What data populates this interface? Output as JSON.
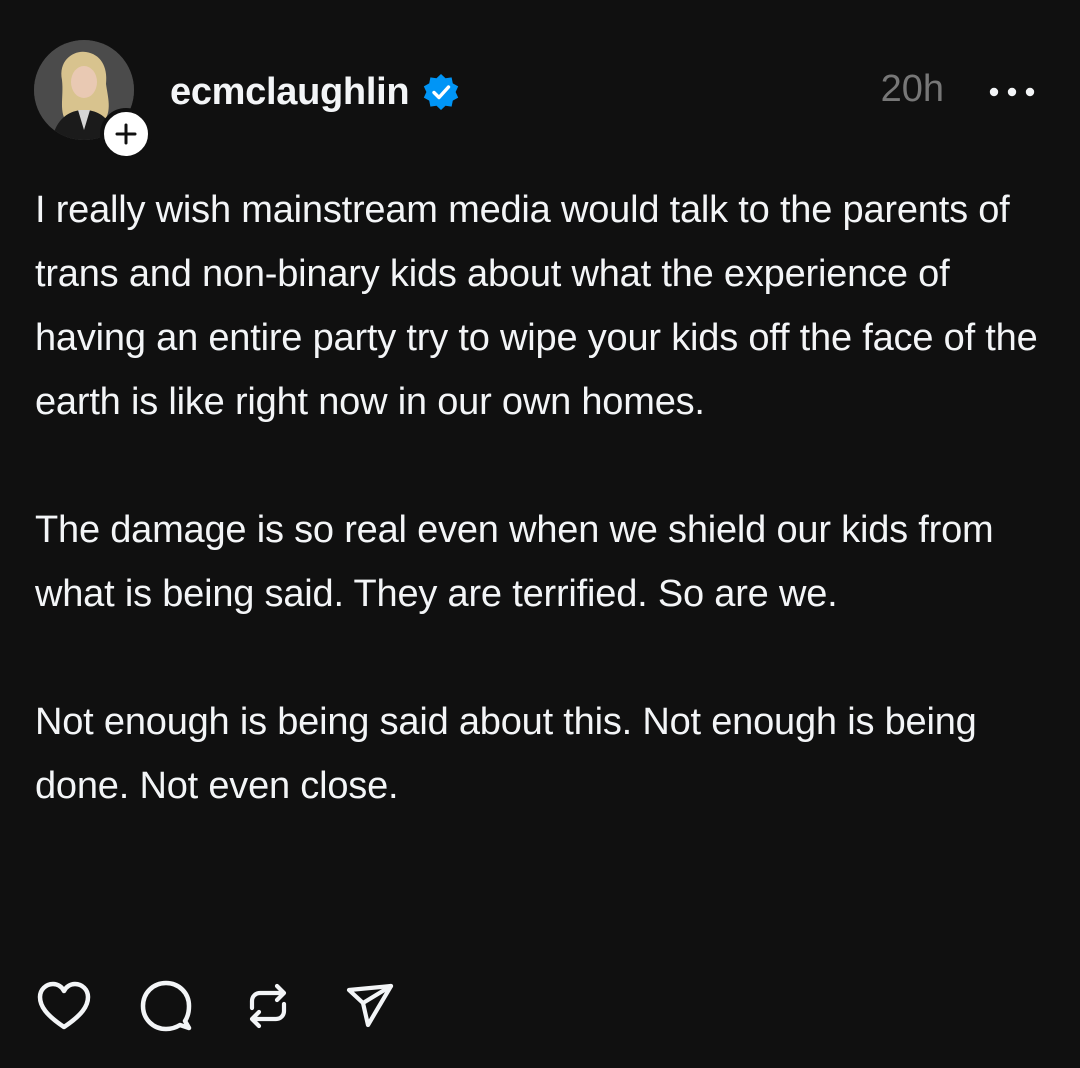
{
  "post": {
    "author": {
      "username": "ecmclaughlin",
      "verified": true,
      "avatar_icon": "profile-photo",
      "follow_icon": "plus-icon"
    },
    "timestamp": "20h",
    "more_icon": "ellipsis-icon",
    "paragraphs": [
      "I really wish mainstream media would talk to the parents of trans and non-binary kids about what the experience of having an entire party try to wipe your kids off the face of the earth is like right now in our own homes.",
      "The damage is so real even when we shield our kids from what is being said. They are terrified. So are we.",
      "Not enough is being said about this. Not enough is being done. Not even close."
    ],
    "actions": [
      "heart-icon",
      "comment-icon",
      "repost-icon",
      "share-icon"
    ]
  },
  "colors": {
    "background": "#101010",
    "text": "#f3f5f7",
    "muted": "#777777",
    "verified": "#0095f6"
  }
}
